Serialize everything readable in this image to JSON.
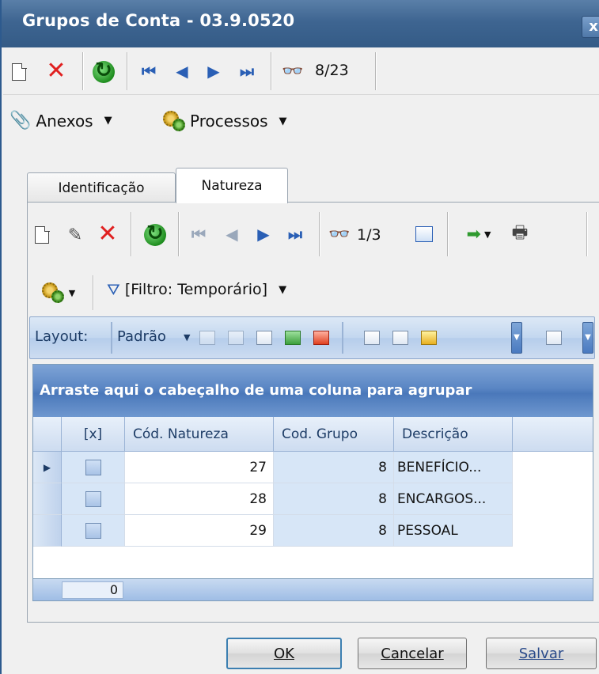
{
  "window": {
    "title": "Grupos de Conta - 03.9.0520",
    "close_glyph": "x"
  },
  "main_toolbar": {
    "icons": [
      "new-icon",
      "delete-icon",
      "refresh-icon",
      "first-icon",
      "prev-icon",
      "next-icon",
      "last-icon",
      "find-icon"
    ],
    "record_counter": "8/23"
  },
  "menus": {
    "anexos": "Anexos",
    "processos": "Processos"
  },
  "tabs": [
    {
      "label": "Identificação",
      "active": false
    },
    {
      "label": "Natureza",
      "active": true
    }
  ],
  "detail_toolbar": {
    "record_counter": "1/3",
    "filter_label": "[Filtro: Temporário]"
  },
  "layout_bar": {
    "label": "Layout:",
    "value": "Padrão"
  },
  "grid": {
    "group_hint": "Arraste aqui o cabeçalho de uma coluna para agrupar",
    "columns": [
      "[x]",
      "Cód. Natureza",
      "Cod. Grupo",
      "Descrição"
    ],
    "rows": [
      {
        "selected_marker": true,
        "cod_natureza": "27",
        "cod_grupo": "8",
        "descricao": "BENEFÍCIO..."
      },
      {
        "selected_marker": false,
        "cod_natureza": "28",
        "cod_grupo": "8",
        "descricao": "ENCARGOS..."
      },
      {
        "selected_marker": false,
        "cod_natureza": "29",
        "cod_grupo": "8",
        "descricao": "PESSOAL"
      }
    ],
    "footer_total": "0"
  },
  "buttons": {
    "ok": "OK",
    "cancel": "Cancelar",
    "save": "Salvar"
  },
  "colors": {
    "title_bar": "#3e6591",
    "grid_header_blue": "#5a86c4",
    "delete_red": "#e02020",
    "refresh_green": "#1e8c1e"
  }
}
